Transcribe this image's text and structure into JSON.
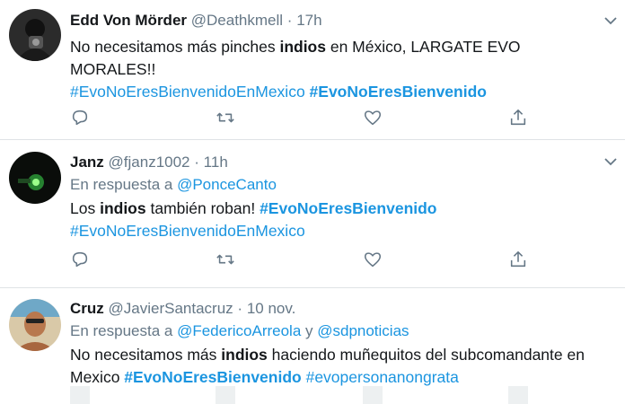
{
  "colors": {
    "link": "#1b95e0",
    "muted": "#657786",
    "text": "#14171a",
    "border": "#dfe3e6"
  },
  "tweets": [
    {
      "name": "Edd Von Mörder",
      "handle": "@Deathkmell",
      "dot": "·",
      "time": "17h",
      "body": {
        "p1": "No necesitamos más pinches ",
        "b1": "indios",
        "p2": " en México, LARGATE EVO MORALES!!",
        "tag1": "#EvoNoEresBienvenidoEnMexico",
        "tag2": "#EvoNoEresBienvenido"
      }
    },
    {
      "name": "Janz",
      "handle": "@fjanz1002",
      "dot": "·",
      "time": "11h",
      "reply_prefix": "En respuesta a ",
      "reply_to": "@PonceCanto",
      "body": {
        "p1": "Los ",
        "b1": "indios",
        "p2": " también roban! ",
        "tag1": "#EvoNoEresBienvenido",
        "tag2": "#EvoNoEresBienvenidoEnMexico"
      }
    },
    {
      "name": "Cruz",
      "handle": "@JavierSantacruz",
      "dot": "·",
      "time": "10 nov.",
      "reply_prefix": "En respuesta a ",
      "reply_to_1": "@FedericoArreola",
      "reply_and": " y ",
      "reply_to_2": "@sdpnoticias",
      "body": {
        "p1": "No necesitamos más ",
        "b1": "indios",
        "p2": " haciendo muñequitos del subcomandante en Mexico ",
        "tag1": "#EvoNoEresBienvenido",
        "tag2": "#evopersonanongrata"
      }
    }
  ],
  "icons": {
    "reply": "reply-icon",
    "retweet": "retweet-icon",
    "like": "like-icon",
    "share": "share-icon",
    "caret": "chevron-down-icon"
  }
}
